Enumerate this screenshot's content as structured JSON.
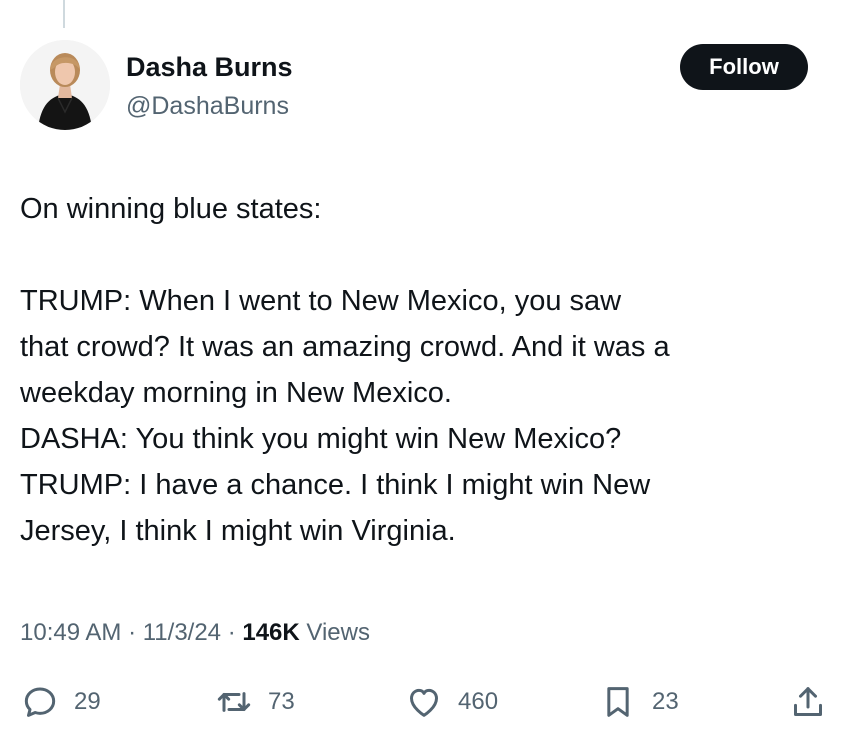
{
  "author": {
    "display_name": "Dasha Burns",
    "handle": "@DashaBurns"
  },
  "follow_button": {
    "label": "Follow"
  },
  "tweet": {
    "lines": [
      "On winning blue states:",
      "",
      "TRUMP: When I went to New Mexico, you saw",
      "that crowd? It was an amazing crowd. And it was a",
      "weekday morning in New Mexico.",
      "DASHA: You think you might win New Mexico?",
      "TRUMP: I have a chance. I think I might win New",
      "Jersey, I think I might win Virginia."
    ]
  },
  "meta": {
    "time": "10:49 AM",
    "separator": " · ",
    "date": "11/3/24",
    "views_count": "146K",
    "views_label": " Views"
  },
  "actions": {
    "replies": {
      "icon": "reply-icon",
      "count": "29"
    },
    "reposts": {
      "icon": "repost-icon",
      "count": "73"
    },
    "likes": {
      "icon": "like-icon",
      "count": "460"
    },
    "bookmarks": {
      "icon": "bookmark-icon",
      "count": "23"
    },
    "share": {
      "icon": "share-icon"
    }
  },
  "colors": {
    "text_primary": "#0f1419",
    "text_secondary": "#536471",
    "follow_bg": "#0f1419",
    "follow_text": "#ffffff"
  }
}
